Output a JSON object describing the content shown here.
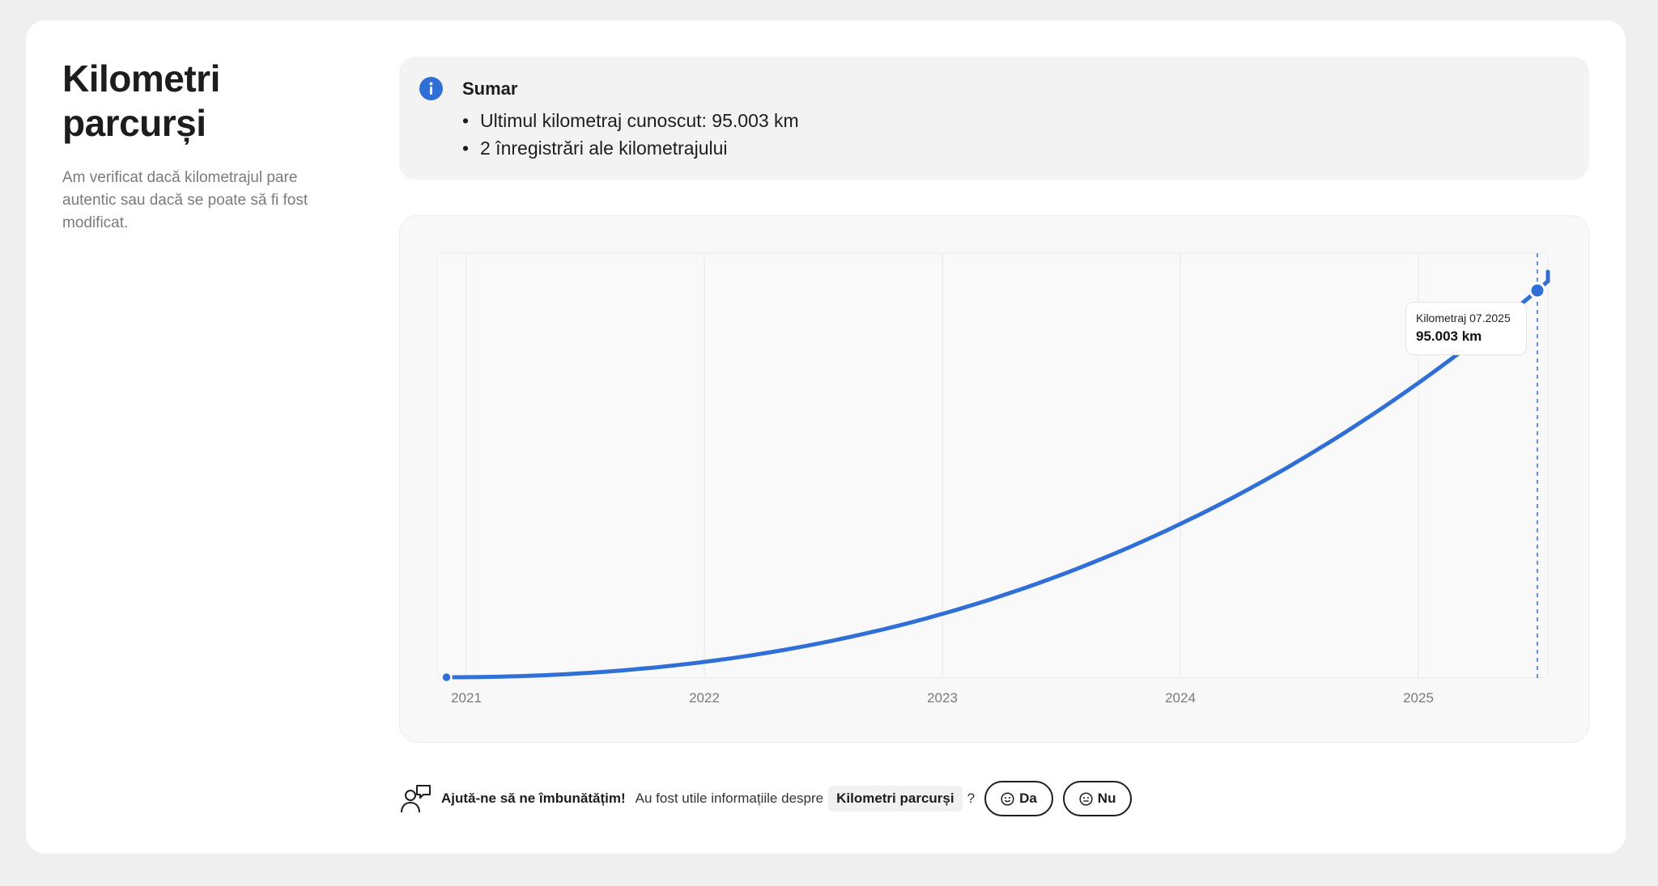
{
  "page": {
    "title_line1": "Kilometri",
    "title_line2": "parcurși",
    "description": "Am verificat dacă kilometrajul pare autentic sau dacă se poate să fi fost modificat."
  },
  "summary": {
    "icon": "info-icon",
    "title": "Sumar",
    "items": [
      "Ultimul kilometraj cunoscut: 95.003 km",
      "2 înregistrări ale kilometrajului"
    ]
  },
  "colors": {
    "accent": "#2f6fd6",
    "grid": "#e6e6e6",
    "axis_text": "#7a7a7a"
  },
  "chart_data": {
    "type": "line",
    "series": [
      {
        "x": [
          "2020-12",
          "2025-07"
        ],
        "y": [
          0,
          95003
        ]
      }
    ],
    "xticks": [
      "2021",
      "2022",
      "2023",
      "2024",
      "2025"
    ],
    "curve": "smooth",
    "grid": "vertical",
    "tooltip": {
      "label": "Kilometraj 07.2025",
      "value": "95.003 km"
    }
  },
  "feedback": {
    "icon": "feedback-person-icon",
    "strong": "Ajută-ne să ne îmbunătățim!",
    "text": "Au fost utile informațiile despre",
    "topic": "Kilometri parcurși",
    "question_mark": "?",
    "yes_label": "Da",
    "no_label": "Nu"
  }
}
